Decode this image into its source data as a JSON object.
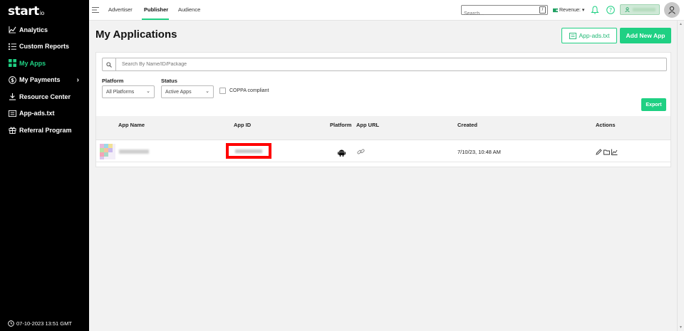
{
  "brand": {
    "name": "start",
    "suffix": "io",
    "accent": "#1fd083"
  },
  "sidebar": {
    "items": [
      {
        "label": "Analytics",
        "icon": "chart-line-icon",
        "active": false
      },
      {
        "label": "Custom Reports",
        "icon": "list-icon",
        "active": false
      },
      {
        "label": "My Apps",
        "icon": "apps-grid-icon",
        "active": true
      },
      {
        "label": "My Payments",
        "icon": "dollar-icon",
        "active": false
      },
      {
        "label": "Resource Center",
        "icon": "download-icon",
        "active": false
      },
      {
        "label": "App-ads.txt",
        "icon": "document-icon",
        "active": false
      },
      {
        "label": "Referral Program",
        "icon": "gift-icon",
        "active": false
      }
    ],
    "chevron": "›",
    "footer_time": "07-10-2023 13:51 GMT"
  },
  "topbar": {
    "tabs": [
      {
        "label": "Advertiser",
        "active": false
      },
      {
        "label": "Publisher",
        "active": true
      },
      {
        "label": "Audience",
        "active": false
      }
    ],
    "search_placeholder": "Search...",
    "search_shortcut": "/",
    "revenue_label": "Revenue: ▾"
  },
  "page": {
    "title": "My Applications",
    "ads_button": "App-ads.txt",
    "add_button": "Add New App"
  },
  "filters": {
    "search_placeholder": "Search By Name/ID/Package",
    "platform_label": "Platform",
    "platform_value": "All Platforms",
    "status_label": "Status",
    "status_value": "Active Apps",
    "coppa_label": "COPPA compliant",
    "export_button": "Export"
  },
  "table": {
    "headers": {
      "app_name": "App Name",
      "app_id": "App ID",
      "platform": "Platform",
      "app_url": "App URL",
      "created": "Created",
      "actions": "Actions"
    },
    "rows": [
      {
        "created": "7/10/23, 10:48 AM",
        "platform": "android-icon",
        "app_url_icon": "link-icon"
      }
    ]
  }
}
